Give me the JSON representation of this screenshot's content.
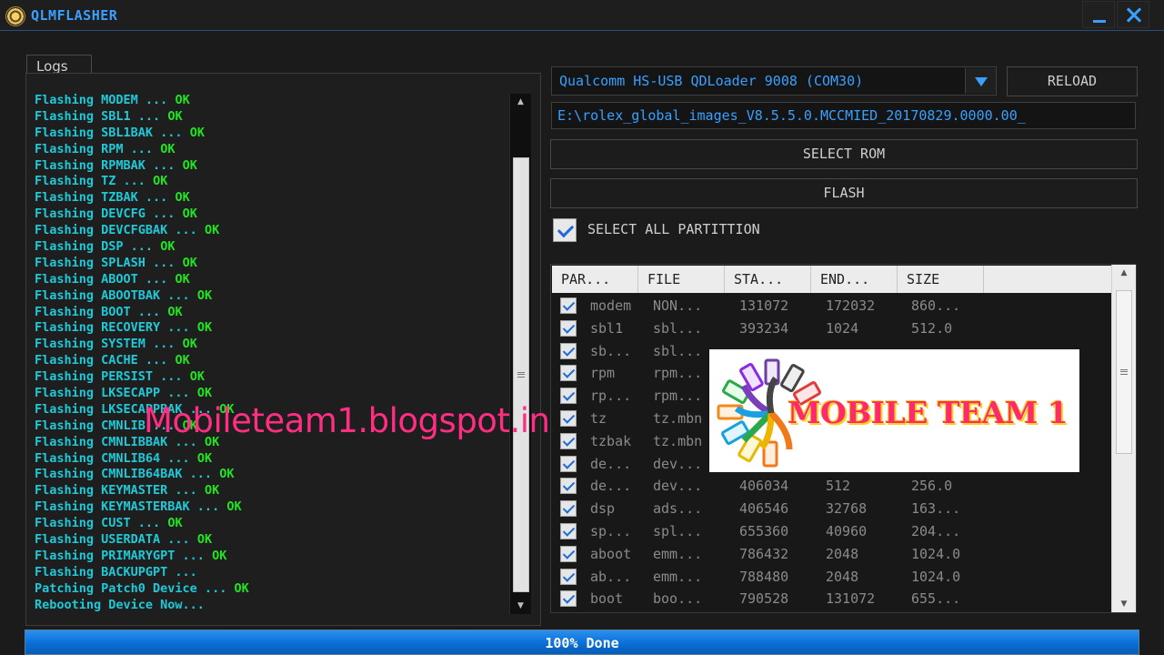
{
  "app": {
    "title": "QLMFLASHER"
  },
  "logs": {
    "tab_label": "Logs",
    "lines": [
      {
        "text": "Flashing MODEM ...",
        "ok": "OK"
      },
      {
        "text": "Flashing SBL1 ...",
        "ok": "OK"
      },
      {
        "text": "Flashing SBL1BAK ...",
        "ok": "OK"
      },
      {
        "text": "Flashing RPM ...",
        "ok": "OK"
      },
      {
        "text": "Flashing RPMBAK ...",
        "ok": "OK"
      },
      {
        "text": "Flashing TZ ...",
        "ok": "OK"
      },
      {
        "text": "Flashing TZBAK ...",
        "ok": "OK"
      },
      {
        "text": "Flashing DEVCFG ...",
        "ok": "OK"
      },
      {
        "text": "Flashing DEVCFGBAK ...",
        "ok": "OK"
      },
      {
        "text": "Flashing DSP ...",
        "ok": "OK"
      },
      {
        "text": "Flashing SPLASH ...",
        "ok": "OK"
      },
      {
        "text": "Flashing ABOOT ...",
        "ok": "OK"
      },
      {
        "text": "Flashing ABOOTBAK ...",
        "ok": "OK"
      },
      {
        "text": "Flashing BOOT ...",
        "ok": "OK"
      },
      {
        "text": "Flashing RECOVERY ...",
        "ok": "OK"
      },
      {
        "text": "Flashing SYSTEM ...",
        "ok": "OK"
      },
      {
        "text": "Flashing CACHE ...",
        "ok": "OK"
      },
      {
        "text": "Flashing PERSIST ...",
        "ok": "OK"
      },
      {
        "text": "Flashing LKSECAPP ...",
        "ok": "OK"
      },
      {
        "text": "Flashing LKSECAPPBAK ...",
        "ok": "OK"
      },
      {
        "text": "Flashing CMNLIB ...",
        "ok": "OK"
      },
      {
        "text": "Flashing CMNLIBBAK ...",
        "ok": "OK"
      },
      {
        "text": "Flashing CMNLIB64 ...",
        "ok": "OK"
      },
      {
        "text": "Flashing CMNLIB64BAK ...",
        "ok": "OK"
      },
      {
        "text": "Flashing KEYMASTER ...",
        "ok": "OK"
      },
      {
        "text": "Flashing KEYMASTERBAK ...",
        "ok": "OK"
      },
      {
        "text": "Flashing CUST ...",
        "ok": "OK"
      },
      {
        "text": "Flashing USERDATA ...",
        "ok": "OK"
      },
      {
        "text": "Flashing PRIMARYGPT ...",
        "ok": "OK"
      },
      {
        "text": "Flashing BACKUPGPT ...",
        "ok": ""
      },
      {
        "text": "Patching Patch0 Device ...",
        "ok": "OK"
      },
      {
        "text": "Rebooting Device Now...",
        "ok": ""
      }
    ]
  },
  "controls": {
    "port_value": "Qualcomm HS-USB QDLoader 9008 (COM30)",
    "reload_label": "RELOAD",
    "rom_path": "E:\\rolex_global_images_V8.5.5.0.MCCMIED_20170829.0000.00_",
    "select_rom_label": "SELECT ROM",
    "flash_label": "FLASH",
    "select_all_label": "SELECT ALL PARTITTION"
  },
  "table": {
    "columns": [
      "PAR...",
      "FILE",
      "STA...",
      "END...",
      "SIZE"
    ],
    "rows": [
      {
        "part": "modem",
        "file": "NON...",
        "start": "131072",
        "end": "172032",
        "size": "860..."
      },
      {
        "part": "sbl1",
        "file": "sbl...",
        "start": "393234",
        "end": "1024",
        "size": "512.0"
      },
      {
        "part": "sb...",
        "file": "sbl...",
        "start": "",
        "end": "",
        "size": ""
      },
      {
        "part": "rpm",
        "file": "rpm...",
        "start": "",
        "end": "",
        "size": ""
      },
      {
        "part": "rp...",
        "file": "rpm...",
        "start": "",
        "end": "",
        "size": ""
      },
      {
        "part": "tz",
        "file": "tz.mbn",
        "start": "",
        "end": "",
        "size": ""
      },
      {
        "part": "tzbak",
        "file": "tz.mbn",
        "start": "",
        "end": "",
        "size": ""
      },
      {
        "part": "de...",
        "file": "dev...",
        "start": "",
        "end": "",
        "size": ""
      },
      {
        "part": "de...",
        "file": "dev...",
        "start": "406034",
        "end": "512",
        "size": "256.0"
      },
      {
        "part": "dsp",
        "file": "ads...",
        "start": "406546",
        "end": "32768",
        "size": "163..."
      },
      {
        "part": "sp...",
        "file": "spl...",
        "start": "655360",
        "end": "40960",
        "size": "204..."
      },
      {
        "part": "aboot",
        "file": "emm...",
        "start": "786432",
        "end": "2048",
        "size": "1024.0"
      },
      {
        "part": "ab...",
        "file": "emm...",
        "start": "788480",
        "end": "2048",
        "size": "1024.0"
      },
      {
        "part": "boot",
        "file": "boo...",
        "start": "790528",
        "end": "131072",
        "size": "655..."
      }
    ]
  },
  "overlay": {
    "watermark": "Mobileteam1.blogspot.in",
    "logo_text": "MOBILE TEAM 1"
  },
  "progress": {
    "label": "100% Done",
    "fraction": 1.0
  },
  "colors": {
    "accent": "#3aa0ff",
    "log_text": "#1ec9d8",
    "ok_text": "#21e521",
    "watermark": "#ff2e82",
    "progress_fill": "#0a6fd6"
  }
}
